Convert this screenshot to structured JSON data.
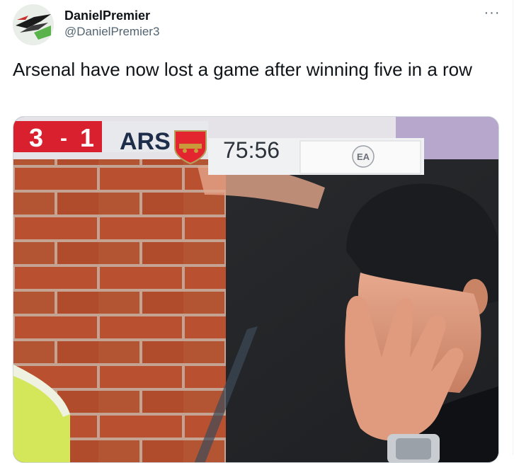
{
  "tweet": {
    "author": {
      "display_name": "DanielPremier",
      "handle": "@DanielPremier3"
    },
    "more_label": "···",
    "text": "Arsenal have now lost a game after winning five in a row"
  },
  "media": {
    "scoreboard": {
      "home_score": "3",
      "separator": "-",
      "away_score": "1",
      "team": "ARS",
      "clock": "75:56",
      "sponsor_logo": "EA"
    }
  },
  "colors": {
    "score_red": "#d8202f",
    "handle_gray": "#536471",
    "text_dark": "#0f1419"
  },
  "icons": {
    "more": "more-dots-icon",
    "crest": "arsenal-crest-icon",
    "sponsor": "ea-sports-logo"
  }
}
